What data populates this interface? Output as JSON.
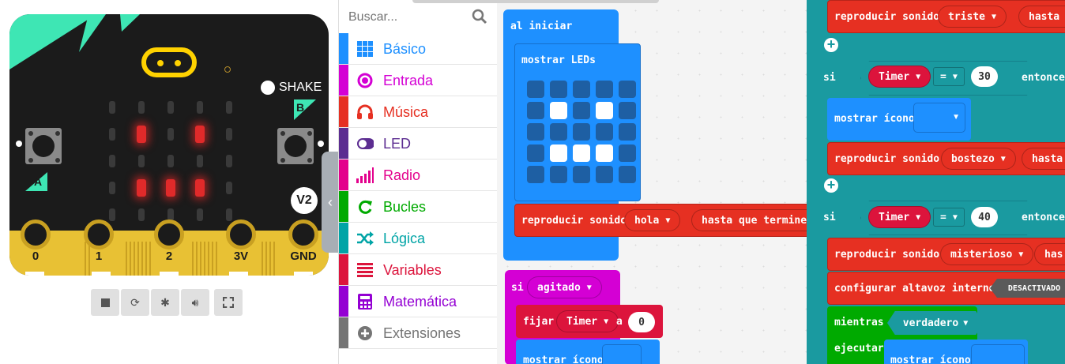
{
  "simulator": {
    "shake_label": "SHAKE",
    "button_a": "A",
    "button_b": "B",
    "version_badge": "V2",
    "pins": [
      "0",
      "1",
      "2",
      "3V",
      "GND"
    ],
    "toolbar": [
      "stop-icon",
      "restart-icon",
      "debug-icon",
      "volume-icon",
      "fullscreen-icon"
    ]
  },
  "toolbox": {
    "search_placeholder": "Buscar...",
    "categories": [
      {
        "label": "Básico",
        "color": "#1e90ff",
        "icon": "grid-icon"
      },
      {
        "label": "Entrada",
        "color": "#d400d4",
        "icon": "input-icon"
      },
      {
        "label": "Música",
        "color": "#e63022",
        "icon": "headphones-icon"
      },
      {
        "label": "LED",
        "color": "#5c2d91",
        "icon": "toggle-icon"
      },
      {
        "label": "Radio",
        "color": "#e3008c",
        "icon": "signal-icon"
      },
      {
        "label": "Bucles",
        "color": "#00aa00",
        "icon": "loop-icon"
      },
      {
        "label": "Lógica",
        "color": "#00a4a6",
        "icon": "shuffle-icon"
      },
      {
        "label": "Variables",
        "color": "#dc143c",
        "icon": "lines-icon"
      },
      {
        "label": "Matemática",
        "color": "#9400d3",
        "icon": "calculator-icon"
      },
      {
        "label": "Extensiones",
        "color": "#757575",
        "icon": "plus-circle-icon"
      }
    ]
  },
  "workspace": {
    "on_start": {
      "label": "al iniciar",
      "show_leds": "mostrar LEDs",
      "play_sound": "reproducir sonido",
      "sound": "hola",
      "until": "hasta que termine"
    },
    "on_shake": {
      "if_label": "si",
      "event": "agitado",
      "set_label": "fijar",
      "var": "Timer",
      "to": "a",
      "value": "0",
      "show_icon": "mostrar ícono"
    },
    "right": {
      "play_sound": "reproducir sonido",
      "sound_sad": "triste",
      "until_cut": "hasta q",
      "if_label": "si",
      "var": "Timer",
      "op": "=",
      "v30": "30",
      "then": "entonces",
      "show_icon": "mostrar ícono",
      "sound_yawn": "bostezo",
      "until_cut2": "hasta",
      "v40": "40",
      "then2": "entonces",
      "sound_myst": "misterioso",
      "until_cut3": "has",
      "speaker": "configurar altavoz interno",
      "speaker_state": "DESACTIVADO",
      "while": "mientras",
      "true": "verdadero",
      "do": "ejecutar"
    }
  }
}
